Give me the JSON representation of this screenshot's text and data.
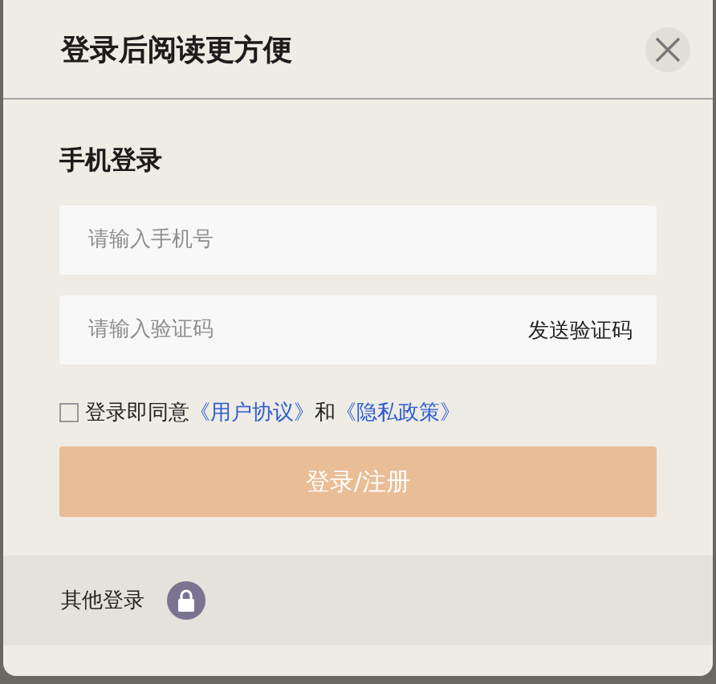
{
  "dialog": {
    "title": "登录后阅读更方便"
  },
  "phone_login": {
    "heading": "手机登录",
    "phone_field": {
      "placeholder": "请输入手机号"
    },
    "code_field": {
      "placeholder": "请输入验证码"
    },
    "send_code": "发送验证码",
    "agreement": {
      "checked": false,
      "text": "登录即同意",
      "link_1": "《用户协议》",
      "joiner": "和",
      "link_2": "《隐私政策》"
    },
    "submit": "登录/注册"
  },
  "footer": {
    "label": "其他登录"
  }
}
